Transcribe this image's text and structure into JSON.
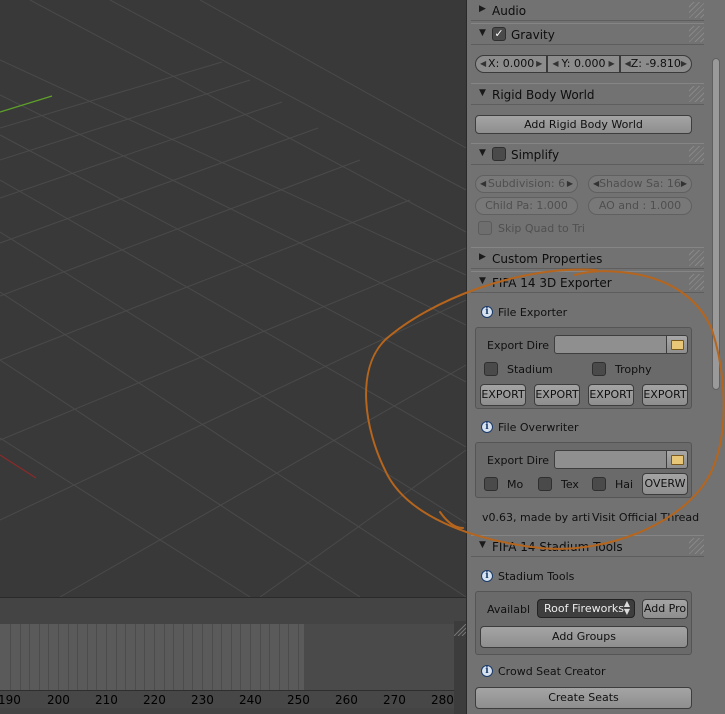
{
  "timeline": {
    "ticks": [
      "190",
      "200",
      "210",
      "220",
      "230",
      "240",
      "250",
      "260",
      "270",
      "280"
    ]
  },
  "panels": {
    "audio": {
      "label": "Audio",
      "collapsed_icon": "triangle-right-icon"
    },
    "gravity": {
      "label": "Gravity",
      "checked": true,
      "x": "X: 0.000",
      "y": "Y: 0.000",
      "z": "Z: -9.810"
    },
    "rigid_body_world": {
      "label": "Rigid Body World",
      "add_button": "Add Rigid Body World"
    },
    "simplify": {
      "label": "Simplify",
      "checked": false,
      "subdivision": "Subdivision: 6",
      "shadow": "Shadow Sa: 16",
      "child": "Child Pa: 1.000",
      "ao": "AO and : 1.000",
      "skip_quad": "Skip Quad to Tri"
    },
    "custom_properties": {
      "label": "Custom Properties"
    },
    "fifa_exporter": {
      "label": "FIFA 14 3D Exporter",
      "file_exporter": {
        "title": "File Exporter",
        "export_dir_label": "Export Dire",
        "export_dir_value": "",
        "stadium": "Stadium",
        "trophy": "Trophy",
        "export_buttons": [
          "EXPORT",
          "EXPORT",
          "EXPORT",
          "EXPORT"
        ]
      },
      "file_overwriter": {
        "title": "File Overwriter",
        "export_dir_label": "Export Dire",
        "export_dir_value": "",
        "mo": "Mo",
        "tex": "Tex",
        "hai": "Hai",
        "overwrite_button": "OVERW"
      },
      "version": "v0.63, made by arti",
      "thread_link": "Visit Official Thread"
    },
    "stadium_tools": {
      "label": "FIFA 14 Stadium Tools",
      "section_title": "Stadium Tools",
      "available_label": "Availabl",
      "selected_option": "Roof Fireworks",
      "add_pro_button": "Add Pro",
      "add_groups_button": "Add Groups",
      "crowd_title": "Crowd Seat Creator",
      "create_seats_button": "Create Seats"
    }
  },
  "colors": {
    "panel_bg": "#727272",
    "viewport_bg": "#393939",
    "annotation_stroke": "#b5651d",
    "grid_line": "#4a4a4a",
    "axis_green": "#5ea12a",
    "axis_red": "#8a2a2a"
  }
}
